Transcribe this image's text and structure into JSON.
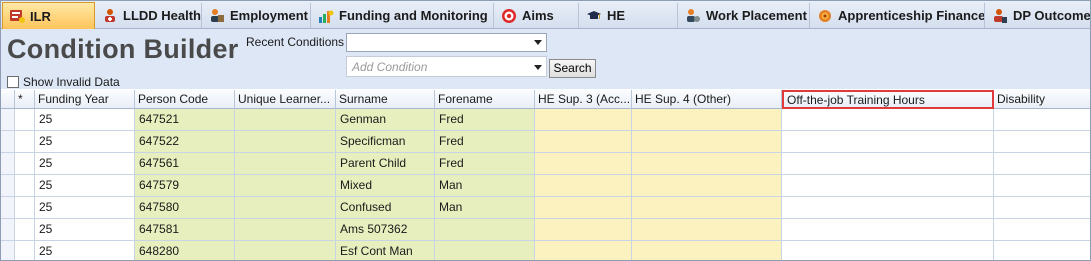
{
  "tabs": [
    {
      "label": "ILR",
      "icon": "ilr-icon",
      "active": true
    },
    {
      "label": "LLDD Health",
      "icon": "health-icon",
      "active": false
    },
    {
      "label": "Employment",
      "icon": "employment-icon",
      "active": false
    },
    {
      "label": "Funding and Monitoring",
      "icon": "funding-icon",
      "active": false
    },
    {
      "label": "Aims",
      "icon": "target-icon",
      "active": false
    },
    {
      "label": "HE",
      "icon": "graduation-cap-icon",
      "active": false
    },
    {
      "label": "Work Placement",
      "icon": "work-placement-icon",
      "active": false
    },
    {
      "label": "Apprenticeship Finance",
      "icon": "finance-icon",
      "active": false
    },
    {
      "label": "DP Outcome",
      "icon": "dp-outcome-icon",
      "active": false
    }
  ],
  "header": {
    "title": "Condition Builder",
    "recent_conditions_label": "Recent Conditions",
    "recent_conditions_value": "",
    "add_condition_placeholder": "Add Condition",
    "search_label": "Search",
    "show_invalid_label": "Show Invalid Data",
    "show_invalid_checked": false
  },
  "grid": {
    "columns": [
      {
        "key": "star",
        "label": "*"
      },
      {
        "key": "funding_year",
        "label": "Funding Year"
      },
      {
        "key": "person_code",
        "label": "Person Code"
      },
      {
        "key": "uln",
        "label": "Unique Learner..."
      },
      {
        "key": "surname",
        "label": "Surname"
      },
      {
        "key": "forename",
        "label": "Forename"
      },
      {
        "key": "he_sup3",
        "label": "HE Sup. 3 (Acc..."
      },
      {
        "key": "he_sup4",
        "label": "HE Sup. 4 (Other)"
      },
      {
        "key": "otj_hours",
        "label": "Off-the-job Training Hours"
      },
      {
        "key": "disability",
        "label": "Disability"
      }
    ],
    "rows": [
      {
        "funding_year": "25",
        "person_code": "647521",
        "uln": "",
        "surname": "Genman",
        "forename": "Fred",
        "he_sup3": "",
        "he_sup4": "",
        "otj_hours": "",
        "disability": ""
      },
      {
        "funding_year": "25",
        "person_code": "647522",
        "uln": "",
        "surname": "Specificman",
        "forename": "Fred",
        "he_sup3": "",
        "he_sup4": "",
        "otj_hours": "",
        "disability": ""
      },
      {
        "funding_year": "25",
        "person_code": "647561",
        "uln": "",
        "surname": "Parent Child",
        "forename": "Fred",
        "he_sup3": "",
        "he_sup4": "",
        "otj_hours": "",
        "disability": ""
      },
      {
        "funding_year": "25",
        "person_code": "647579",
        "uln": "",
        "surname": "Mixed",
        "forename": "Man",
        "he_sup3": "",
        "he_sup4": "",
        "otj_hours": "",
        "disability": ""
      },
      {
        "funding_year": "25",
        "person_code": "647580",
        "uln": "",
        "surname": "Confused",
        "forename": "Man",
        "he_sup3": "",
        "he_sup4": "",
        "otj_hours": "",
        "disability": ""
      },
      {
        "funding_year": "25",
        "person_code": "647581",
        "uln": "",
        "surname": "Ams 507362",
        "forename": "",
        "he_sup3": "",
        "he_sup4": "",
        "otj_hours": "",
        "disability": ""
      },
      {
        "funding_year": "25",
        "person_code": "648280",
        "uln": "",
        "surname": "Esf Cont Man",
        "forename": "",
        "he_sup3": "",
        "he_sup4": "",
        "otj_hours": "",
        "disability": ""
      }
    ]
  },
  "colors": {
    "active_tab": "#ffc45a",
    "header_bg": "#dde7f6",
    "green_cell": "#e7efbf",
    "yellow_cell": "#fbf2c0",
    "highlight_border": "#e03a3a"
  }
}
